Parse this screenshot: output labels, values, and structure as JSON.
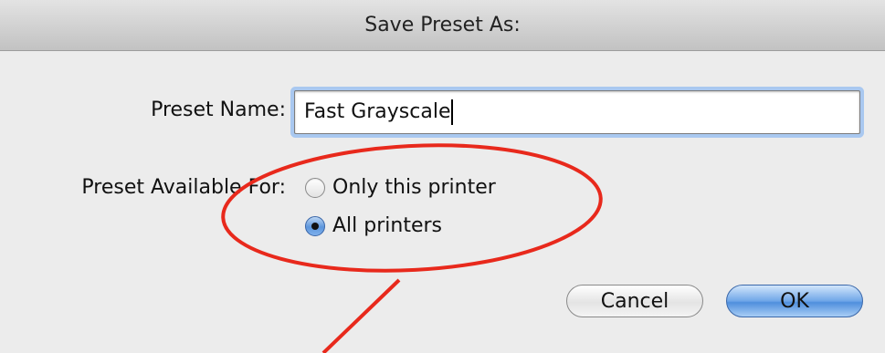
{
  "dialog": {
    "title": "Save Preset As:",
    "preset_name_label": "Preset Name:",
    "preset_name_value": "Fast Grayscale",
    "available_label": "Preset Available For:",
    "options": [
      {
        "label": "Only this printer",
        "selected": false
      },
      {
        "label": "All printers",
        "selected": true
      }
    ],
    "cancel_label": "Cancel",
    "ok_label": "OK"
  },
  "annotation": {
    "color": "#e8291c",
    "shape": "ellipse-with-arrow"
  }
}
